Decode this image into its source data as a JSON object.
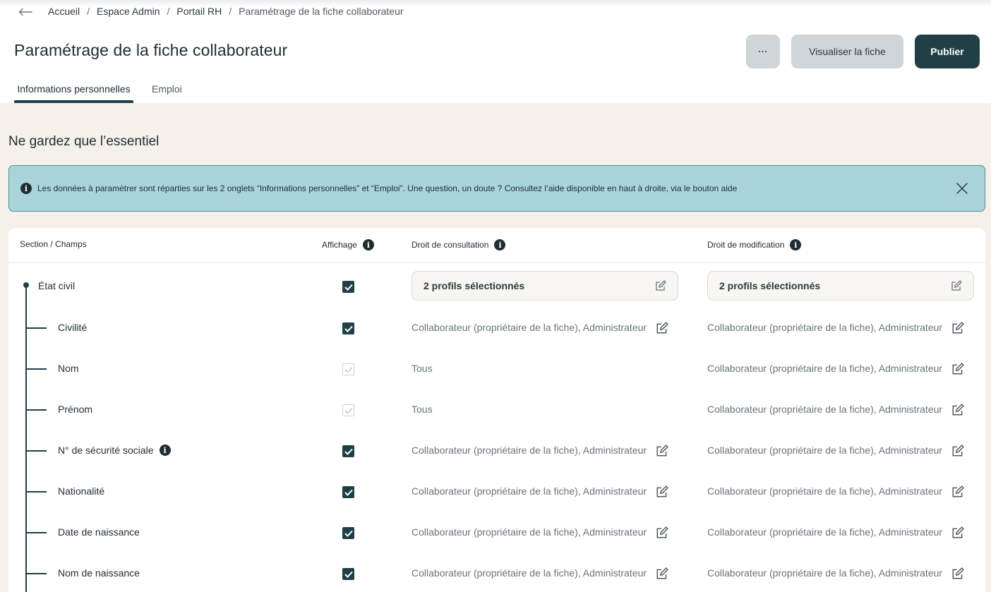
{
  "breadcrumb": {
    "items": [
      "Accueil",
      "Espace Admin",
      "Portail RH"
    ],
    "current": "Paramétrage de la fiche collaborateur",
    "separator": "/"
  },
  "page": {
    "title": "Paramétrage de la fiche collaborateur"
  },
  "actions": {
    "more_label": "···",
    "view_label": "Visualiser la fiche",
    "publish_label": "Publier"
  },
  "tabs": [
    {
      "label": "Informations personnelles",
      "active": true
    },
    {
      "label": "Emploi",
      "active": false
    }
  ],
  "section": {
    "heading": "Ne gardez que l’essentiel"
  },
  "banner": {
    "text": "Les données à paramétrer sont réparties sur les 2 onglets “Informations personnelles” et “Emploi”. Une question, un doute ? Consultez l’aide disponible en haut à droite, via le bouton aide"
  },
  "table": {
    "headers": {
      "section": "Section / Champs",
      "display": "Affichage",
      "consultation": "Droit de consultation",
      "modification": "Droit de modification"
    },
    "group": {
      "label": "État civil",
      "checked": true,
      "consultation": "2 profils sélectionnés",
      "modification": "2 profils sélectionnés"
    },
    "rows": [
      {
        "label": "Civilité",
        "checked": true,
        "disabled": false,
        "consultation": "Collaborateur (propriétaire de la fiche), Administrateur",
        "consultation_editable": true,
        "modification": "Collaborateur (propriétaire de la fiche), Administrateur",
        "info": false
      },
      {
        "label": "Nom",
        "checked": true,
        "disabled": true,
        "consultation": "Tous",
        "consultation_editable": false,
        "modification": "Collaborateur (propriétaire de la fiche), Administrateur",
        "info": false
      },
      {
        "label": "Prénom",
        "checked": true,
        "disabled": true,
        "consultation": "Tous",
        "consultation_editable": false,
        "modification": "Collaborateur (propriétaire de la fiche), Administrateur",
        "info": false
      },
      {
        "label": "N° de sécurité sociale",
        "checked": true,
        "disabled": false,
        "consultation": "Collaborateur (propriétaire de la fiche), Administrateur",
        "consultation_editable": true,
        "modification": "Collaborateur (propriétaire de la fiche), Administrateur",
        "info": true
      },
      {
        "label": "Nationalité",
        "checked": true,
        "disabled": false,
        "consultation": "Collaborateur (propriétaire de la fiche), Administrateur",
        "consultation_editable": true,
        "modification": "Collaborateur (propriétaire de la fiche), Administrateur",
        "info": false
      },
      {
        "label": "Date de naissance",
        "checked": true,
        "disabled": false,
        "consultation": "Collaborateur (propriétaire de la fiche), Administrateur",
        "consultation_editable": true,
        "modification": "Collaborateur (propriétaire de la fiche), Administrateur",
        "info": false
      },
      {
        "label": "Nom de naissance",
        "checked": true,
        "disabled": false,
        "consultation": "Collaborateur (propriétaire de la fiche), Administrateur",
        "consultation_editable": true,
        "modification": "Collaborateur (propriétaire de la fiche), Administrateur",
        "info": false
      }
    ]
  },
  "colors": {
    "primary": "#213f46",
    "banner_bg": "#a9d4d9",
    "page_bg": "#f5f0ea",
    "secondary_button": "#cfd5d8"
  },
  "icons": {
    "back": "arrow-left-icon",
    "close": "close-icon",
    "info": "info-icon",
    "edit": "edit-icon",
    "check": "checkmark-icon"
  }
}
